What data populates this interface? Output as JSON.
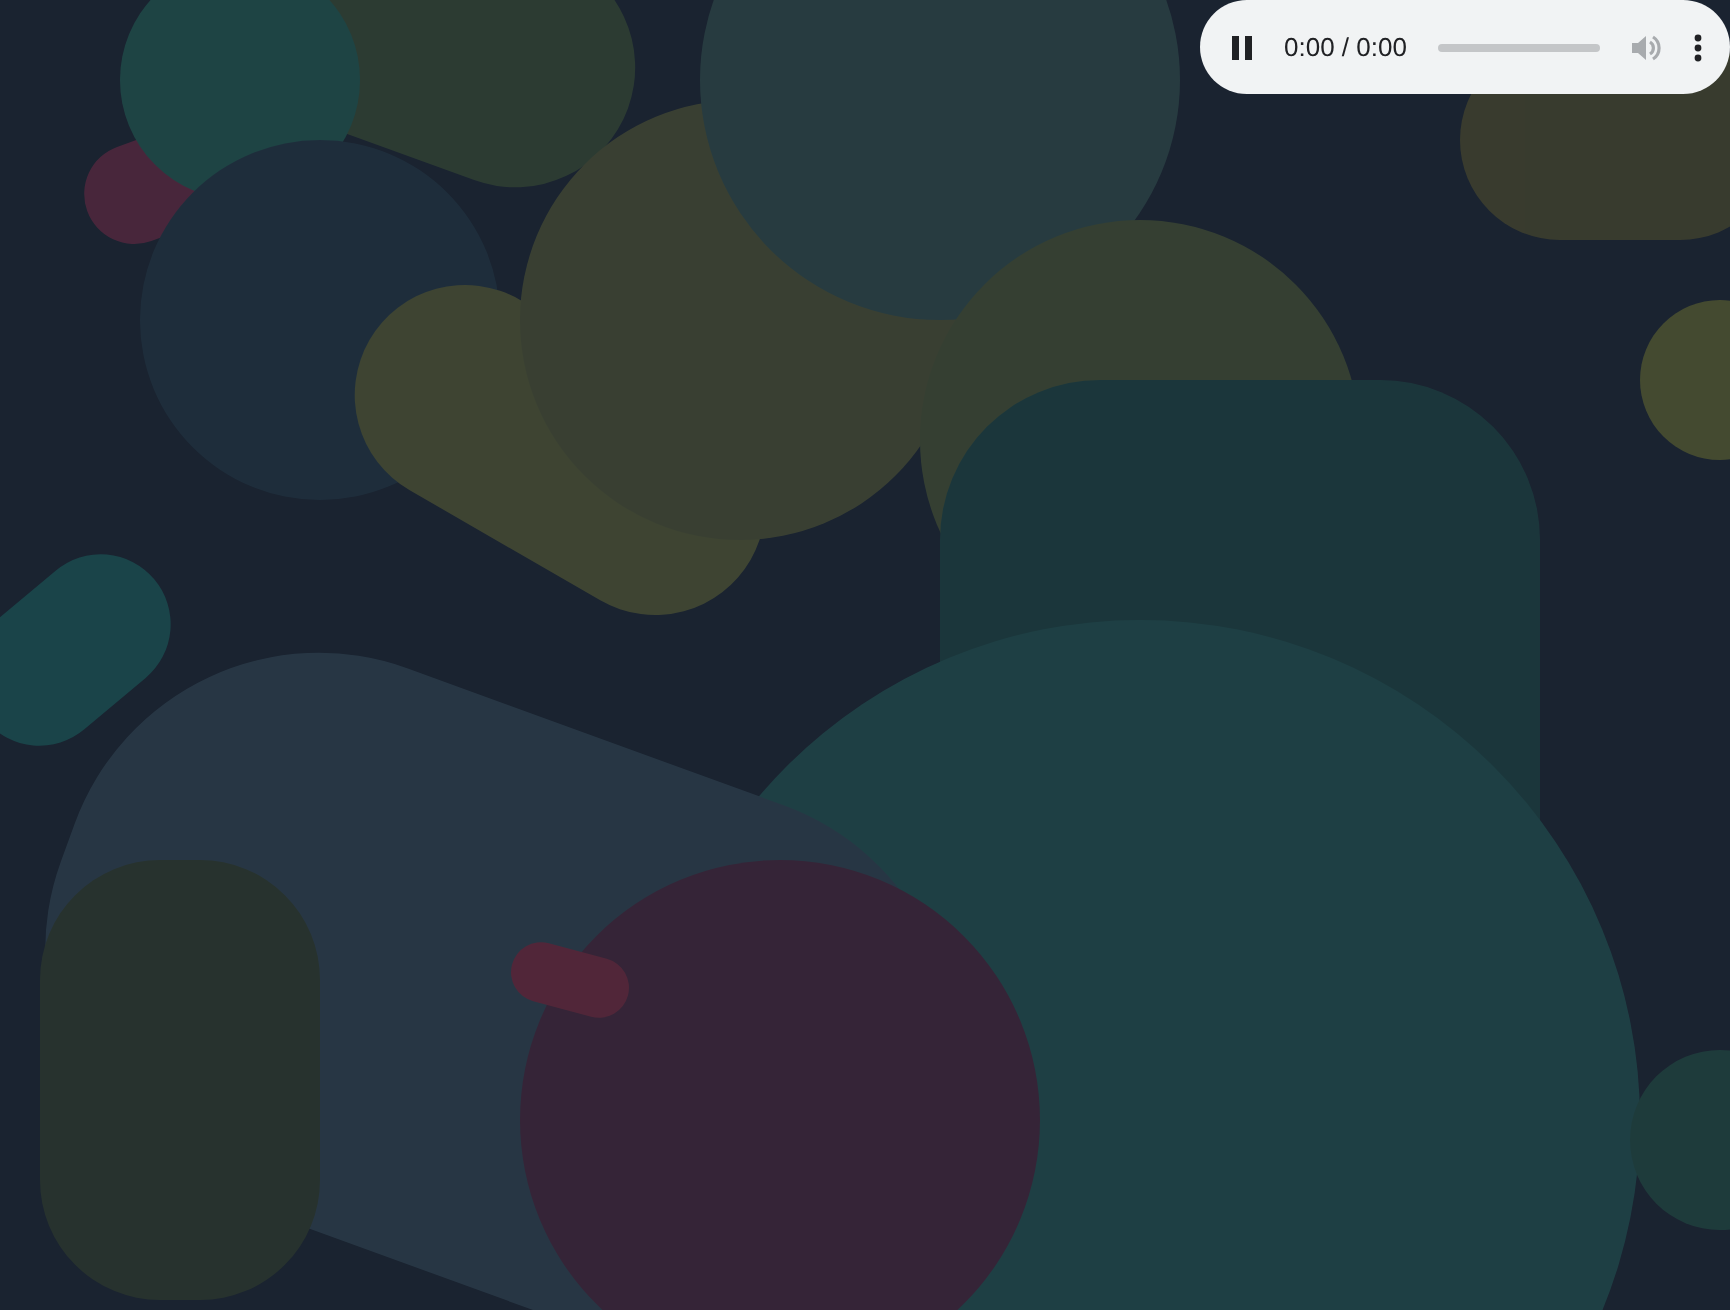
{
  "audio_player": {
    "playing": true,
    "time": "0:00 / 0:00",
    "volume_enabled": false
  }
}
